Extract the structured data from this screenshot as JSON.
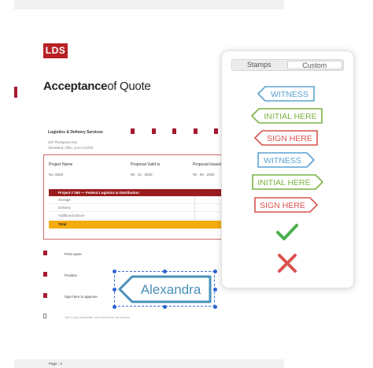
{
  "document": {
    "logo": "LDS",
    "title_bold": "Acceptance",
    "title_rest": "of Quote",
    "company": "Logistics & Delivery Services",
    "address_line1": "427 Thompson Ave",
    "address_line2": "Cleveland, Ohio, U.S.A 12743",
    "proposal_name_label": "Project Name",
    "proposal_name_value": "No. 8263",
    "valid_to_label": "Proposal Valid to",
    "valid_to_value": "08 . 12 . 2020",
    "issued_label": "Proposal Issued",
    "issued_value": "06 . 06 . 2020",
    "project_title": "Project # 265 — Federal Logistics & Distribution",
    "rows": [
      "Storage",
      "Delivery",
      "Additional labour"
    ],
    "total_label": "Total",
    "print_name_label": "Print name",
    "position_label": "Position",
    "sign_label": "Sign here to approve",
    "hint": "Tick if you would like us to send you an invoice",
    "page_label": "Page : 4"
  },
  "signature_stamp": {
    "text": "Alexandra",
    "color": "#4a90b8"
  },
  "panel": {
    "tabs": [
      "Stamps",
      "Custom"
    ],
    "active_tab": "Custom",
    "stamps": [
      {
        "name": "stamp-witness-blue-left",
        "text": "WITNESS",
        "color": "#5ba3d0",
        "dir": "left"
      },
      {
        "name": "stamp-initial-here-green-left",
        "text": "INITIAL HERE",
        "color": "#7cb342",
        "dir": "left"
      },
      {
        "name": "stamp-sign-here-red-left",
        "text": "SIGN HERE",
        "color": "#d9534f",
        "dir": "left"
      },
      {
        "name": "stamp-witness-blue-right",
        "text": "WITNESS",
        "color": "#5ba3d0",
        "dir": "right"
      },
      {
        "name": "stamp-initial-here-green-right",
        "text": "INITIAL HERE",
        "color": "#7cb342",
        "dir": "right"
      },
      {
        "name": "stamp-sign-here-red-right",
        "text": "SIGN HERE",
        "color": "#d9534f",
        "dir": "right"
      }
    ],
    "check_color": "#4caf50",
    "cross_color": "#d9534f"
  }
}
